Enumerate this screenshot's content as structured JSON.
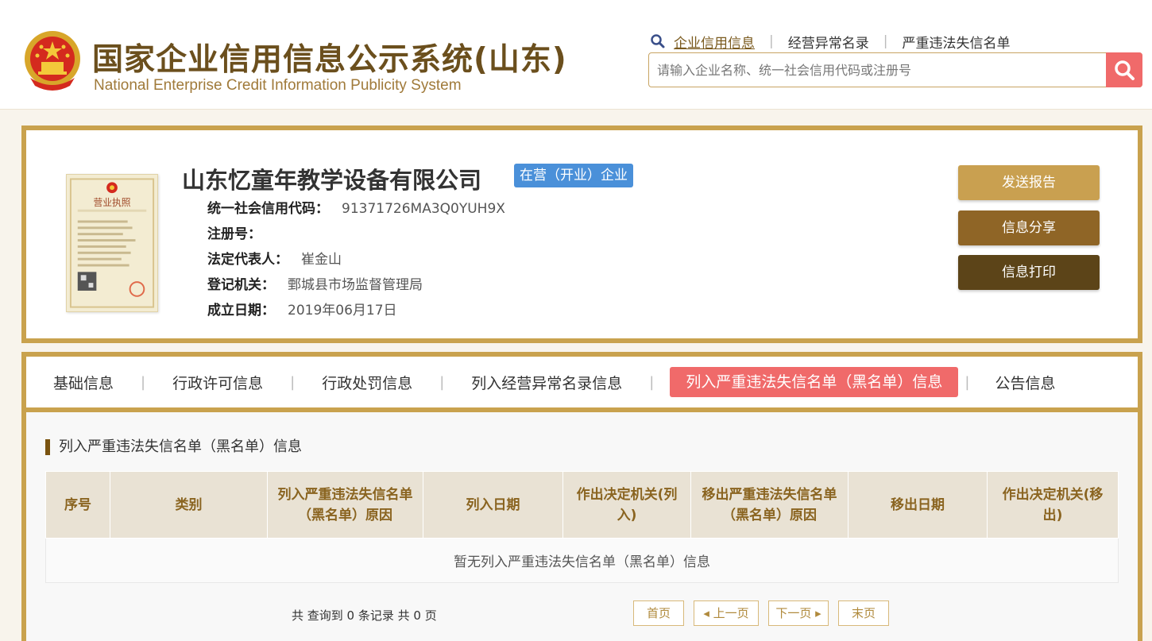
{
  "header": {
    "title": "国家企业信用信息公示系统(山东)",
    "subtitle": "National Enterprise Credit Information Publicity System",
    "nav": [
      "企业信用信息",
      "经营异常名录",
      "严重违法失信名单"
    ],
    "search_placeholder": "请输入企业名称、统一社会信用代码或注册号"
  },
  "company": {
    "name": "山东忆童年教学设备有限公司",
    "status": "在营（开业）企业",
    "license_image_label": "营业执照",
    "fields": [
      {
        "label": "统一社会信用代码：",
        "value": "91371726MA3Q0YUH9X"
      },
      {
        "label": "注册号：",
        "value": ""
      },
      {
        "label": "法定代表人：",
        "value": "崔金山"
      },
      {
        "label": "登记机关：",
        "value": "鄄城县市场监督管理局"
      },
      {
        "label": "成立日期：",
        "value": "2019年06月17日"
      }
    ],
    "actions": {
      "report": "发送报告",
      "share": "信息分享",
      "print": "信息打印"
    }
  },
  "tabs": [
    {
      "label": "基础信息",
      "active": false
    },
    {
      "label": "行政许可信息",
      "active": false
    },
    {
      "label": "行政处罚信息",
      "active": false
    },
    {
      "label": "列入经营异常名录信息",
      "active": false
    },
    {
      "label": "列入严重违法失信名单（黑名单）信息",
      "active": true
    },
    {
      "label": "公告信息",
      "active": false
    }
  ],
  "section": {
    "title": "列入严重违法失信名单（黑名单）信息",
    "columns": [
      "序号",
      "类别",
      "列入严重违法失信名单（黑名单）原因",
      "列入日期",
      "作出决定机关(列入)",
      "移出严重违法失信名单（黑名单）原因",
      "移出日期",
      "作出决定机关(移出)"
    ],
    "empty_text": "暂无列入严重违法失信名单（黑名单）信息",
    "record_count": "共 查询到 0 条记录 共 0 页",
    "pager": {
      "first": "首页",
      "prev": "◂ 上一页",
      "next": "下一页 ▸",
      "last": "末页"
    }
  },
  "colors": {
    "accent_gold": "#c9a24e",
    "active_tab": "#f06a6a",
    "status_badge": "#4a90d9"
  }
}
